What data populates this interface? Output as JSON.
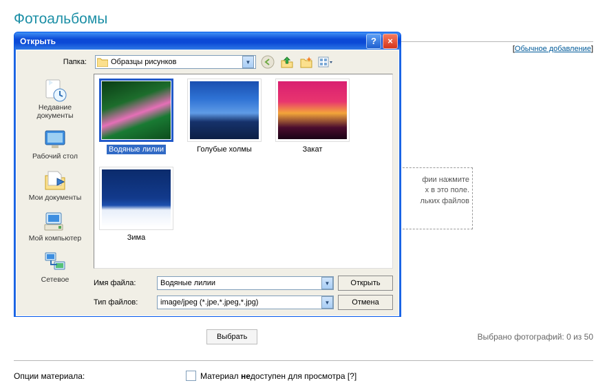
{
  "page": {
    "title": "Фотоальбомы",
    "link": "Обычное добавление",
    "drop_hint_l1": "фии нажмите",
    "drop_hint_l2": "х в это поле.",
    "drop_hint_l3": "льких файлов",
    "select_button": "Выбрать",
    "count_text": "Выбрано фотографий: 0 из 50",
    "options_label": "Опции материала:",
    "material_prefix": "Материал ",
    "material_bold": "не",
    "material_suffix": "доступен для просмотра [?]"
  },
  "dialog": {
    "title": "Открыть",
    "folder_label": "Папка:",
    "folder_value": "Образцы рисунков",
    "places": {
      "recent": "Недавние документы",
      "desktop": "Рабочий стол",
      "mydocs": "Мои документы",
      "mycomp": "Мой компьютер",
      "network": "Сетевое"
    },
    "files": {
      "f1": "Водяные лилии",
      "f2": "Голубые холмы",
      "f3": "Закат",
      "f4": "Зима"
    },
    "filename_label": "Имя файла:",
    "filename_value": "Водяные лилии",
    "filetype_label": "Тип файлов:",
    "filetype_value": "image/jpeg (*.jpe,*.jpeg,*.jpg)",
    "open_btn": "Открыть",
    "cancel_btn": "Отмена"
  }
}
